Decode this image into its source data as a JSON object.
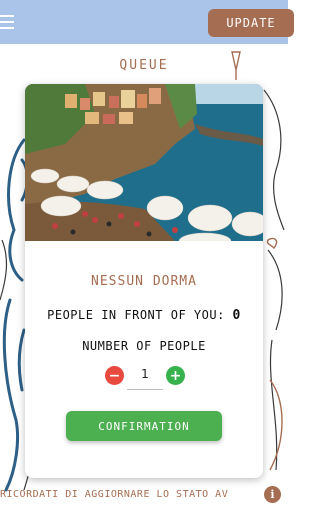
{
  "header": {
    "update_label": "Update",
    "menu_icon": "hamburger-menu-icon"
  },
  "queue": {
    "title": "Queue",
    "event_name": "Nessun Dorma",
    "people_in_front_label": "People in front of you:",
    "people_in_front_value": "0",
    "number_of_people_label": "Number of people",
    "quantity": "1",
    "minus_label": "−",
    "plus_label": "+",
    "confirm_label": "Confirmation"
  },
  "footer": {
    "reminder_text": "Ricordati di aggiornare lo stato av",
    "info_icon": "info-icon",
    "info_symbol": "i"
  },
  "colors": {
    "accent_brown": "#a56e52",
    "topbar_blue": "#a9c4e8",
    "confirm_green": "#4caf50",
    "plus_green": "#37b24d",
    "minus_red": "#e94a3f"
  }
}
